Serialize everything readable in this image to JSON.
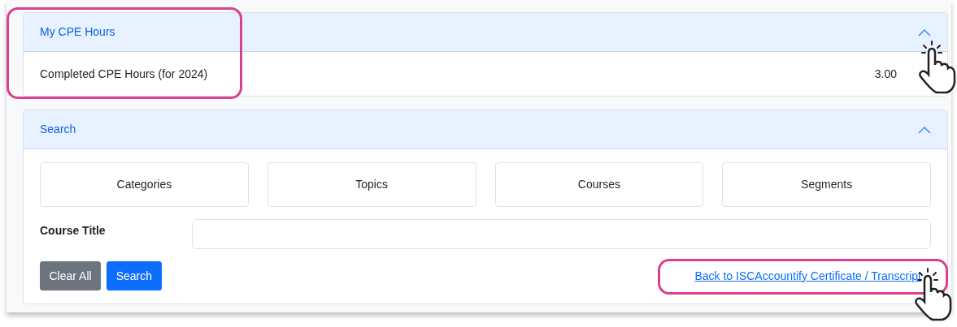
{
  "cpe_panel": {
    "title": "My CPE Hours",
    "expanded": true,
    "label": "Completed CPE Hours (for 2024)",
    "value": "3.00"
  },
  "search_panel": {
    "title": "Search",
    "expanded": true,
    "filter_buttons": [
      "Categories",
      "Topics",
      "Courses",
      "Segments"
    ],
    "course_title": {
      "label": "Course Title"
    },
    "buttons": [
      {
        "label": "Clear All",
        "kind": "secondary"
      },
      {
        "label": "Search",
        "kind": "primary"
      }
    ],
    "back_link": "Back to ISCAccountify Certificate / Transcript"
  }
}
